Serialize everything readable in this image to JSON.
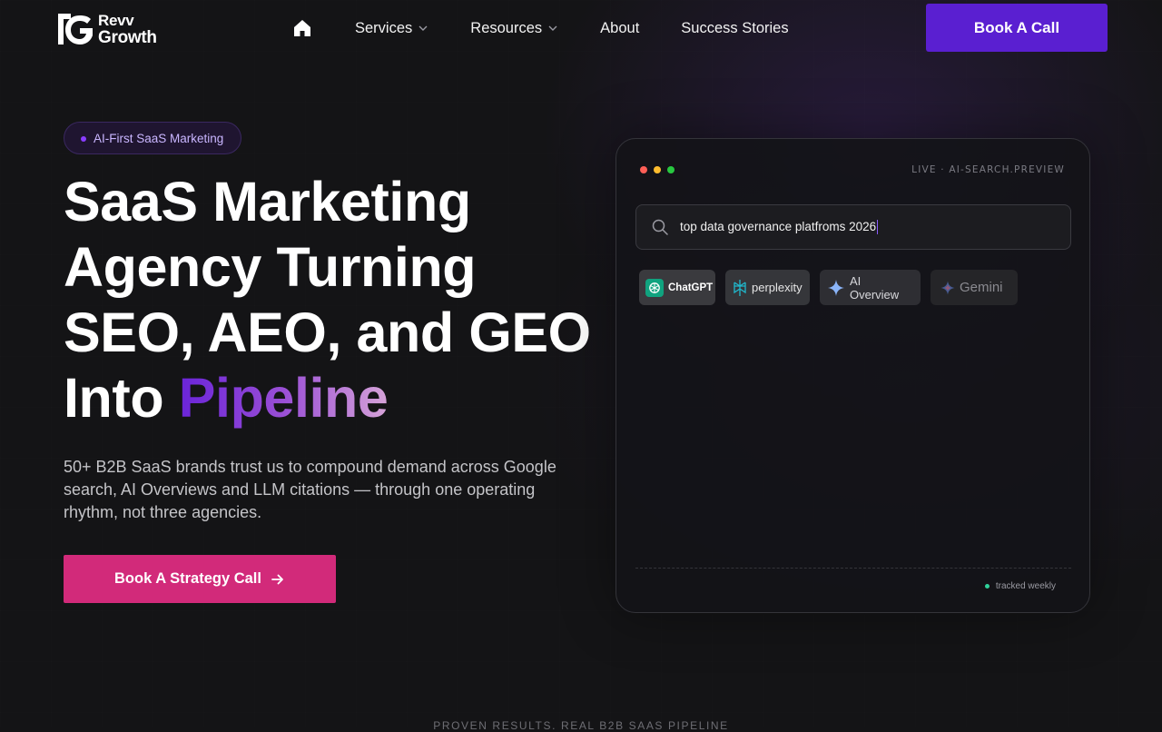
{
  "brand": {
    "line1": "Revv",
    "line2": "Growth"
  },
  "nav": {
    "items": [
      {
        "label": "Services",
        "has_dropdown": true
      },
      {
        "label": "Resources",
        "has_dropdown": true
      },
      {
        "label": "About",
        "has_dropdown": false
      },
      {
        "label": "Success Stories",
        "has_dropdown": false
      }
    ],
    "cta": "Book A Call"
  },
  "hero": {
    "badge": "AI-First SaaS Marketing",
    "title_line1": "SaaS Marketing",
    "title_line2": "Agency Turning",
    "title_line3": "SEO, AEO, and GEO",
    "title_line4_prefix": "Into ",
    "title_highlight": "Pipeline",
    "subtitle": "50+ B2B SaaS brands trust us to compound demand across Google search, AI Overviews and LLM citations — through one operating rhythm, not three agencies.",
    "cta": "Book A Strategy Call"
  },
  "preview": {
    "label": "LIVE · AI-SEARCH.PREVIEW",
    "query": "top data governance platfroms 2026",
    "engines": [
      "ChatGPT",
      "perplexity",
      "AI Overview",
      "Gemini"
    ],
    "footer": "tracked weekly"
  },
  "section_eyebrow": "PROVEN RESULTS. REAL B2B SAAS PIPELINE",
  "colors": {
    "background": "#141416",
    "primary_purple": "#5a1fd1",
    "cta_pink": "#d22a7a",
    "status_green": "#2fd19a"
  }
}
